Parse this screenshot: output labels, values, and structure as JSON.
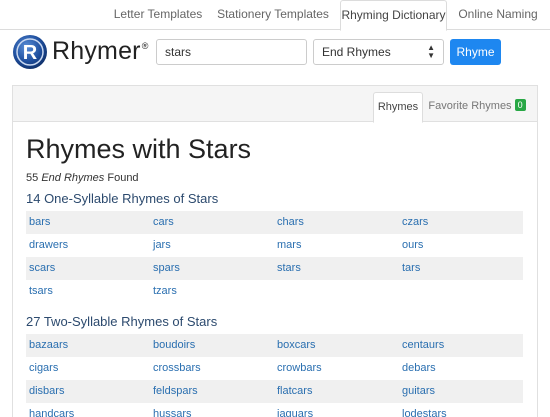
{
  "nav": {
    "tabs": [
      {
        "label": "Letter Templates"
      },
      {
        "label": "Stationery Templates"
      },
      {
        "label": "Rhyming Dictionary",
        "active": true
      },
      {
        "label": "Online Naming"
      }
    ]
  },
  "header": {
    "logo_text": "Rhymer",
    "logo_reg": "®",
    "search_value": "stars",
    "mode_selected": "End Rhymes",
    "submit_label": "Rhyme"
  },
  "panel": {
    "tabs": [
      {
        "label": "Rhymes",
        "active": true
      },
      {
        "label": "Favorite Rhymes",
        "badge": "0"
      }
    ],
    "title": "Rhymes with Stars",
    "found": {
      "count": "55",
      "mode": "End Rhymes",
      "suffix": "Found"
    },
    "sections": [
      {
        "heading": "14 One-Syllable Rhymes of Stars",
        "words": [
          "bars",
          "cars",
          "chars",
          "czars",
          "drawers",
          "jars",
          "mars",
          "ours",
          "scars",
          "spars",
          "stars",
          "tars",
          "tsars",
          "tzars"
        ]
      },
      {
        "heading": "27 Two-Syllable Rhymes of Stars",
        "words": [
          "bazaars",
          "boudoirs",
          "boxcars",
          "centaurs",
          "cigars",
          "crossbars",
          "crowbars",
          "debars",
          "disbars",
          "feldspars",
          "flatcars",
          "guitars",
          "handcars",
          "hussars",
          "jaguars",
          "lodestars"
        ]
      }
    ]
  },
  "colors": {
    "accent": "#1e87f0",
    "link": "#2a6fb0",
    "badge": "#28a745",
    "stripe": "#f0f0f0"
  }
}
